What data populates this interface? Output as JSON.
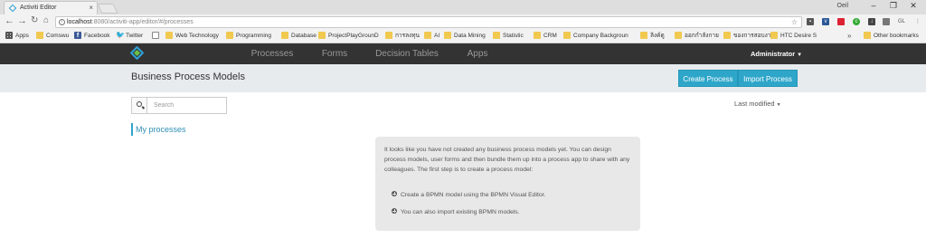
{
  "browser": {
    "tab_title": "Activiti Editor",
    "user": "Oeil",
    "address": {
      "host": "localhost",
      "path": ":8080/activiti-app/editor/#/processes"
    },
    "bookmarks": [
      {
        "label": "Apps",
        "icon": "apps-icon"
      },
      {
        "label": "Comswu",
        "icon": "folder-icon"
      },
      {
        "label": "Facebook",
        "icon": "facebook-icon"
      },
      {
        "label": "Twitter",
        "icon": "twitter-icon"
      },
      {
        "label": "",
        "icon": "page-icon"
      },
      {
        "label": "Web Technology",
        "icon": "folder-icon"
      },
      {
        "label": "Programming",
        "icon": "folder-icon"
      },
      {
        "label": "Database",
        "icon": "folder-icon"
      },
      {
        "label": "ProjectPlayGrounD",
        "icon": "folder-icon"
      },
      {
        "label": "การลงทุน",
        "icon": "folder-icon"
      },
      {
        "label": "AI",
        "icon": "folder-icon"
      },
      {
        "label": "Data Mining",
        "icon": "folder-icon"
      },
      {
        "label": "Statistic",
        "icon": "folder-icon"
      },
      {
        "label": "CRM",
        "icon": "folder-icon"
      },
      {
        "label": "Company Backgroun",
        "icon": "folder-icon"
      },
      {
        "label": "ลิงค์ดู",
        "icon": "folder-icon"
      },
      {
        "label": "ออกกำลังกาย",
        "icon": "folder-icon"
      },
      {
        "label": "ของการสอบงาน",
        "icon": "folder-icon"
      },
      {
        "label": "HTC Desire S",
        "icon": "folder-icon"
      }
    ],
    "more_bookmarks": "»",
    "other_bookmarks": "Other bookmarks",
    "extension_label": "GL"
  },
  "app": {
    "nav": [
      {
        "label": "Processes",
        "active": true
      },
      {
        "label": "Forms",
        "active": false
      },
      {
        "label": "Decision Tables",
        "active": false
      },
      {
        "label": "Apps",
        "active": false
      }
    ],
    "user_menu": "Administrator",
    "page_title": "Business Process Models",
    "actions": {
      "create": "Create Process",
      "import": "Import Process"
    },
    "search": {
      "placeholder": "Search",
      "value": ""
    },
    "sort_label": "Last modified",
    "filter_label": "My processes",
    "empty_state": {
      "intro": "It looks like you have not created any business process models yet. You can design process models, user forms and then bundle them up into a process app to share with any colleagues. The first step is to create a process model:",
      "items": [
        "Create a BPMN model using the BPMN Visual Editor.",
        "You can also import existing BPMN models."
      ]
    }
  },
  "colors": {
    "accent": "#2ea6c9",
    "header": "#333333",
    "subheader": "#e7ebee",
    "panel": "#e8e8e8"
  }
}
